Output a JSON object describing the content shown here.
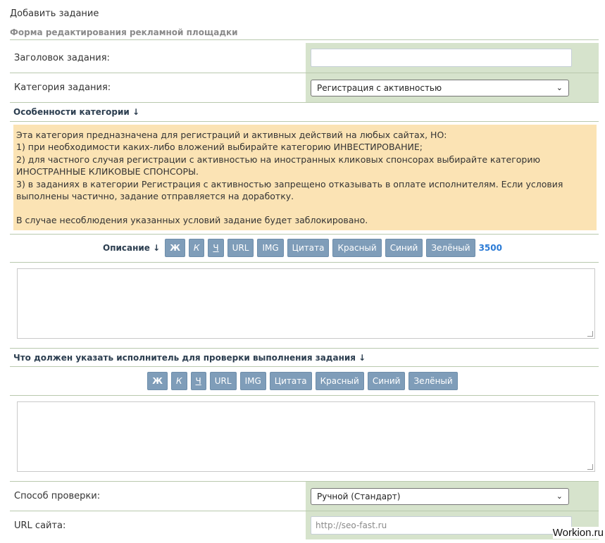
{
  "page": {
    "title": "Добавить задание",
    "form_title": "Форма редактирования рекламной площадки"
  },
  "fields": {
    "task_title_label": "Заголовок задания:",
    "task_title_value": "",
    "category_label": "Категория задания:",
    "category_selected": "Регистрация с активностью",
    "check_method_label": "Способ проверки:",
    "check_method_selected": "Ручной (Стандарт)",
    "site_url_label": "URL сайта:",
    "site_url_placeholder": "http://seo-fast.ru"
  },
  "category_features": {
    "label": "Особенности категории ↓",
    "lines": [
      "Эта категория предназначена для регистраций и активных действий на любых сайтах, НО:",
      "1) при необходимости каких-либо вложений выбирайте категорию ИНВЕСТИРОВАНИЕ;",
      "2) для частного случая регистрации с активностью на иностранных кликовых спонсорах выбирайте категорию",
      "ИНОСТРАННЫЕ КЛИКОВЫЕ СПОНСОРЫ.",
      "3) в заданиях в категории Регистрация с активностью запрещено отказывать в оплате исполнителям. Если условия",
      "выполнены частично, задание отправляется на доработку.",
      "",
      "В случае несоблюдения указанных условий задание будет заблокировано."
    ]
  },
  "description": {
    "label": "Описание ↓",
    "char_limit": "3500",
    "value": ""
  },
  "verification": {
    "label": "Что должен указать исполнитель для проверки выполнения задания ↓",
    "value": ""
  },
  "editor_buttons": {
    "bold": "Ж",
    "italic": "К",
    "underline": "Ч",
    "url": "URL",
    "img": "IMG",
    "quote": "Цитата",
    "red": "Красный",
    "blue": "Синий",
    "green": "Зелёный"
  },
  "watermark": "Workion.ru",
  "colors": {
    "accent_button": "#7f9db9",
    "control_bg": "#d6e3cc",
    "notice_bg": "#fbe3b4",
    "counter": "#2b7bd6"
  }
}
